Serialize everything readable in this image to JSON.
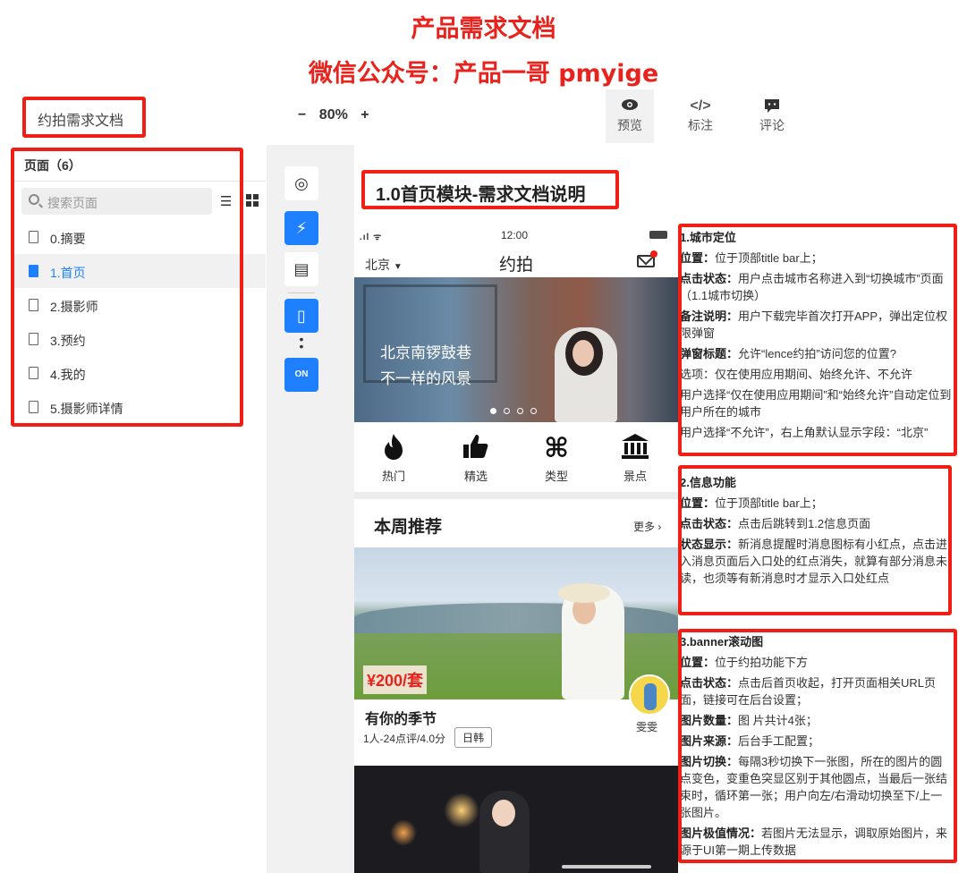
{
  "header": {
    "title": "产品需求文档",
    "subtitle": "微信公众号：产品一哥 pmyige"
  },
  "toolbar": {
    "doc_name": "约拍需求文档",
    "zoom_minus": "−",
    "zoom_level": "80%",
    "zoom_plus": "+",
    "tools": [
      {
        "label": "预览",
        "icon": "eye-icon"
      },
      {
        "label": "标注",
        "icon": "code-icon"
      },
      {
        "label": "评论",
        "icon": "comment-icon"
      }
    ]
  },
  "pages_panel": {
    "title": "页面（6）",
    "search_placeholder": "搜索页面",
    "items": [
      "0.摘要",
      "1.首页",
      "2.摄影师",
      "3.预约",
      "4.我的",
      "5.摄影师详情"
    ],
    "selected": "1.首页"
  },
  "doc": {
    "heading": "1.0首页模块-需求文档说明"
  },
  "phone": {
    "time": "12:00",
    "city": "北京",
    "title": "约拍",
    "banner_line1": "北京南锣鼓巷",
    "banner_line2": "不一样的风景",
    "categories": [
      "热门",
      "精选",
      "类型",
      "景点"
    ],
    "section_title": "本周推荐",
    "more": "更多 ›",
    "card": {
      "price": "¥200/套",
      "title": "有你的季节",
      "meta": "1人-24点评/4.0分",
      "tag": "日韩",
      "photographer": "雯雯"
    }
  },
  "notes": {
    "n1": {
      "title": "1.城市定位",
      "l1k": "位置：",
      "l1v": "位于顶部title bar上；",
      "l2k": "点击状态：",
      "l2v": "用户点击城市名称进入到“切换城市”页面（1.1城市切换）",
      "l3k": "备注说明：",
      "l3v": "用户下载完毕首次打开APP，弹出定位权限弹窗",
      "l4k": "弹窗标题：",
      "l4v": "允许“lence约拍”访问您的位置?",
      "l5": "选项：仅在使用应用期间、始终允许、不允许",
      "l6": "用户选择“仅在使用应用期间”和“始终允许”自动定位到用户所在的城市",
      "l7": "用户选择“不允许”，右上角默认显示字段：“北京”"
    },
    "n2": {
      "title": "2.信息功能",
      "l1k": "位置：",
      "l1v": "位于顶部title bar上；",
      "l2k": "点击状态：",
      "l2v": "点击后跳转到1.2信息页面",
      "l3k": "状态显示：",
      "l3v": "新消息提醒时消息图标有小红点，点击进入消息页面后入口处的红点消失，就算有部分消息未读，也须等有新消息时才显示入口处红点"
    },
    "n3": {
      "title": "3.banner滚动图",
      "l1k": "位置：",
      "l1v": "位于约拍功能下方",
      "l2k": "点击状态：",
      "l2v": "点击后首页收起，打开页面相关URL页面，链接可在后台设置；",
      "l3k": "图片数量：",
      "l3v": "图 片共计4张；",
      "l4k": "图片来源：",
      "l4v": "后台手工配置；",
      "l5k": "图片切换：",
      "l5v": "每隔3秒切换下一张图，所在的图片的圆点变色，变重色突显区别于其他圆点，当最后一张结束时，循环第一张；用户向左/右滑动切换至下/上一张图片。",
      "l6k": "图片极值情况：",
      "l6v": "若图片无法显示，调取原始图片，来源于UI第一期上传数据"
    }
  },
  "colors": {
    "annotation_red": "#f01e14",
    "title_red": "#e8231e",
    "accent_blue": "#1e80ff"
  }
}
